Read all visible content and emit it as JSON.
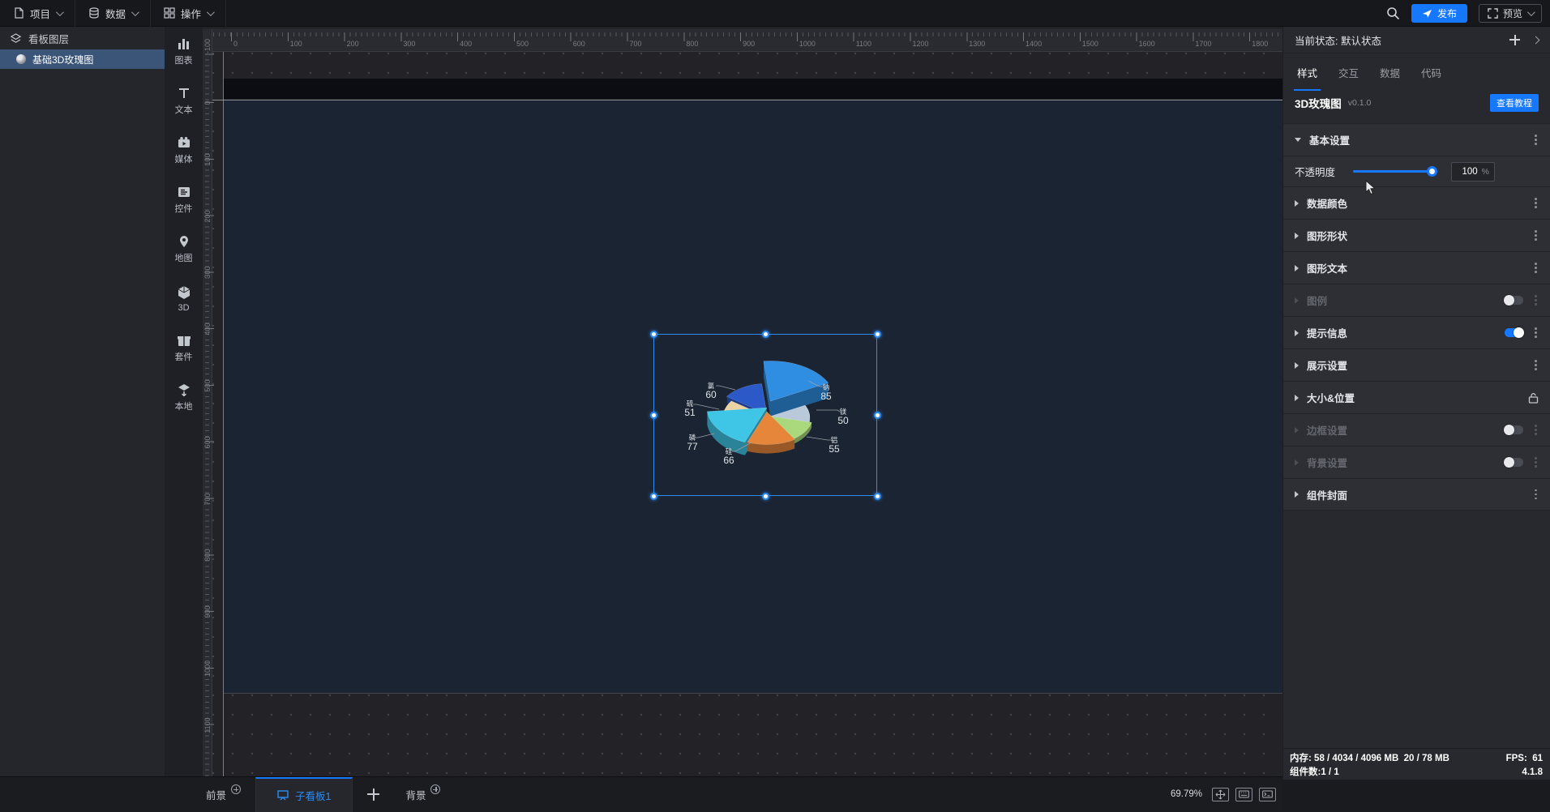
{
  "top_bar": {
    "menus": [
      {
        "label": "项目"
      },
      {
        "label": "数据"
      },
      {
        "label": "操作"
      }
    ],
    "publish_label": "发布",
    "preview_label": "预览"
  },
  "left_panel": {
    "title": "看板图层",
    "layers": [
      {
        "name": "基础3D玫瑰图",
        "selected": true
      }
    ]
  },
  "toolbox": {
    "items": [
      {
        "label": "图表",
        "icon": "chart-icon"
      },
      {
        "label": "文本",
        "icon": "text-icon"
      },
      {
        "label": "媒体",
        "icon": "media-icon"
      },
      {
        "label": "控件",
        "icon": "widget-icon"
      },
      {
        "label": "地图",
        "icon": "map-icon"
      },
      {
        "label": "3D",
        "icon": "cube-3d-icon"
      },
      {
        "label": "套件",
        "icon": "kit-icon"
      },
      {
        "label": "本地",
        "icon": "local-icon"
      }
    ]
  },
  "canvas": {
    "zoom_percent": "69.79%",
    "ruler": {
      "h_min": 0,
      "h_max": 1900,
      "v_min": -100,
      "v_max": 1100,
      "step": 100
    },
    "tabs": {
      "foreground": "前景",
      "board": "子看板1",
      "background": "背景"
    }
  },
  "right_panel": {
    "state_label": "当前状态:",
    "state_value": "默认状态",
    "tabs": [
      "样式",
      "交互",
      "数据",
      "代码"
    ],
    "active_tab": "样式",
    "component": {
      "name": "3D玫瑰图",
      "version": "v0.1.0",
      "tutorial_label": "查看教程"
    },
    "opacity": {
      "label": "不透明度",
      "value": "100",
      "unit": "%"
    },
    "sections": [
      {
        "label": "基本设置",
        "expanded": true,
        "kebab": true
      },
      {
        "label": "数据颜色",
        "kebab": true
      },
      {
        "label": "图形形状",
        "kebab": true
      },
      {
        "label": "图形文本",
        "kebab": true
      },
      {
        "label": "图例",
        "disabled": true,
        "toggle": "off",
        "kebab": true
      },
      {
        "label": "提示信息",
        "toggle": "on",
        "kebab": true
      },
      {
        "label": "展示设置",
        "kebab": true
      },
      {
        "label": "大小&位置",
        "lock": true
      },
      {
        "label": "边框设置",
        "disabled": true,
        "toggle": "off",
        "kebab": true
      },
      {
        "label": "背景设置",
        "disabled": true,
        "toggle": "off",
        "kebab": true
      },
      {
        "label": "组件封面",
        "kebab": true
      }
    ]
  },
  "status_bar": {
    "memory_label": "内存:",
    "memory_value": "58 / 4034 / 4096 MB",
    "memory_value2": "20 / 78 MB",
    "fps_label": "FPS:",
    "fps_value": "61",
    "components_label": "组件数:",
    "components_value": "1 / 1",
    "version": "4.1.8"
  },
  "chart_data": {
    "type": "pie",
    "variant": "3d-rose",
    "title": "",
    "legend": false,
    "series": [
      {
        "name": "钠",
        "value": 85
      },
      {
        "name": "镁",
        "value": 50
      },
      {
        "name": "铝",
        "value": 55
      },
      {
        "name": "硅",
        "value": 66
      },
      {
        "name": "磷",
        "value": 77
      },
      {
        "name": "硫",
        "value": 51
      },
      {
        "name": "氯",
        "value": 60
      }
    ],
    "colors": [
      "#2f8de2",
      "#b9c9da",
      "#a9d97c",
      "#e6863b",
      "#3fc6e6",
      "#ecd2a2",
      "#2b59c8"
    ]
  }
}
